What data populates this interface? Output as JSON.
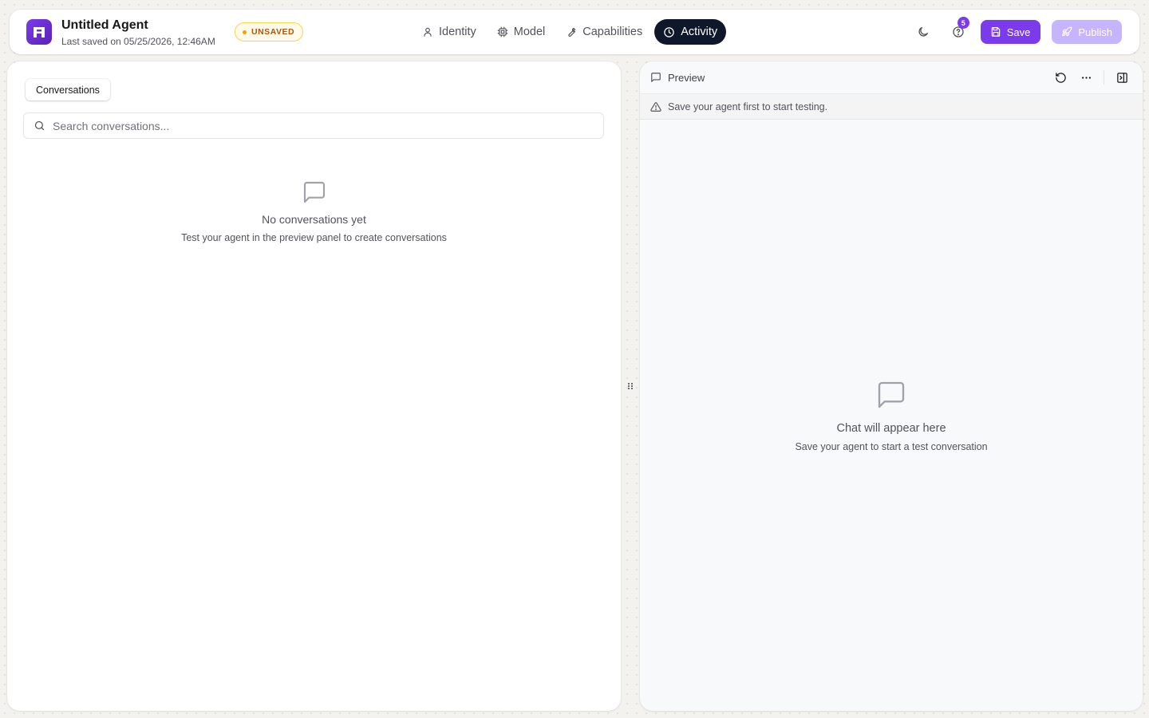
{
  "header": {
    "logo_icon": "app-logo-icon",
    "title": "Untitled Agent",
    "subtitle": "Last saved on 05/25/2026, 12:46AM",
    "status_badge": "UNSAVED",
    "tabs": [
      {
        "label": "Identity",
        "icon": "user-icon",
        "active": false
      },
      {
        "label": "Model",
        "icon": "cpu-icon",
        "active": false
      },
      {
        "label": "Capabilities",
        "icon": "wrench-icon",
        "active": false
      },
      {
        "label": "Activity",
        "icon": "clock-icon",
        "active": true
      }
    ],
    "help_count": "5",
    "save_label": "Save",
    "publish_label": "Publish"
  },
  "conversations": {
    "tab_label": "Conversations",
    "search_placeholder": "Search conversations...",
    "empty_title": "No conversations yet",
    "empty_desc": "Test your agent in the preview panel to create conversations"
  },
  "preview": {
    "title": "Preview",
    "warning": "Save your agent first to start testing.",
    "empty_title": "Chat will appear here",
    "empty_desc": "Save your agent to start a test conversation"
  },
  "colors": {
    "accent": "#7c3aed",
    "accent_disabled": "#c4b5fd",
    "active_tab": "#0f172a",
    "badge_text": "#b45309",
    "badge_bg": "#fffbeb"
  }
}
